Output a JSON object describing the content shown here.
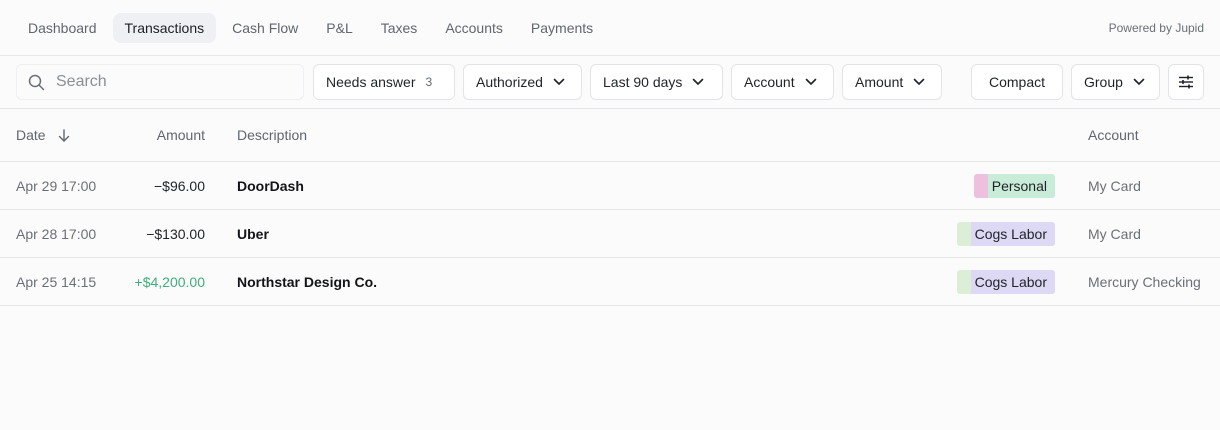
{
  "nav": {
    "tabs": [
      {
        "label": "Dashboard",
        "active": false
      },
      {
        "label": "Transactions",
        "active": true
      },
      {
        "label": "Cash Flow",
        "active": false
      },
      {
        "label": "P&L",
        "active": false
      },
      {
        "label": "Taxes",
        "active": false
      },
      {
        "label": "Accounts",
        "active": false
      },
      {
        "label": "Payments",
        "active": false
      }
    ],
    "powered_by": "Powered by Jupid"
  },
  "filters": {
    "search_placeholder": "Search",
    "search_value": "",
    "needs_answer": {
      "label": "Needs answer",
      "count": "3"
    },
    "authorized": "Authorized",
    "date_range": "Last 90 days",
    "account": "Account",
    "amount": "Amount",
    "compact": "Compact",
    "group": "Group"
  },
  "table": {
    "headers": {
      "date": "Date",
      "amount": "Amount",
      "description": "Description",
      "account": "Account"
    },
    "rows": [
      {
        "date": "Apr 29 17:00",
        "amount": "−$96.00",
        "description": "DoorDash",
        "category": "Personal",
        "account": "My Card"
      },
      {
        "date": "Apr 28 17:00",
        "amount": "−$130.00",
        "description": "Uber",
        "category": "Cogs Labor",
        "account": "My Card"
      },
      {
        "date": "Apr 25 14:15",
        "amount": "+$4,200.00",
        "description": "Northstar Design Co.",
        "category": "Cogs Labor",
        "account": "Mercury Checking"
      }
    ]
  },
  "colors": {
    "positive_amount": "#3fae79",
    "personal_tag_bg": "#c9ecd8",
    "personal_tag_strip": "#eec0e0",
    "cogs_tag_bg": "#ddd8f3",
    "cogs_tag_strip": "#dcefd6",
    "active_tab_bg": "#eef0f4"
  }
}
